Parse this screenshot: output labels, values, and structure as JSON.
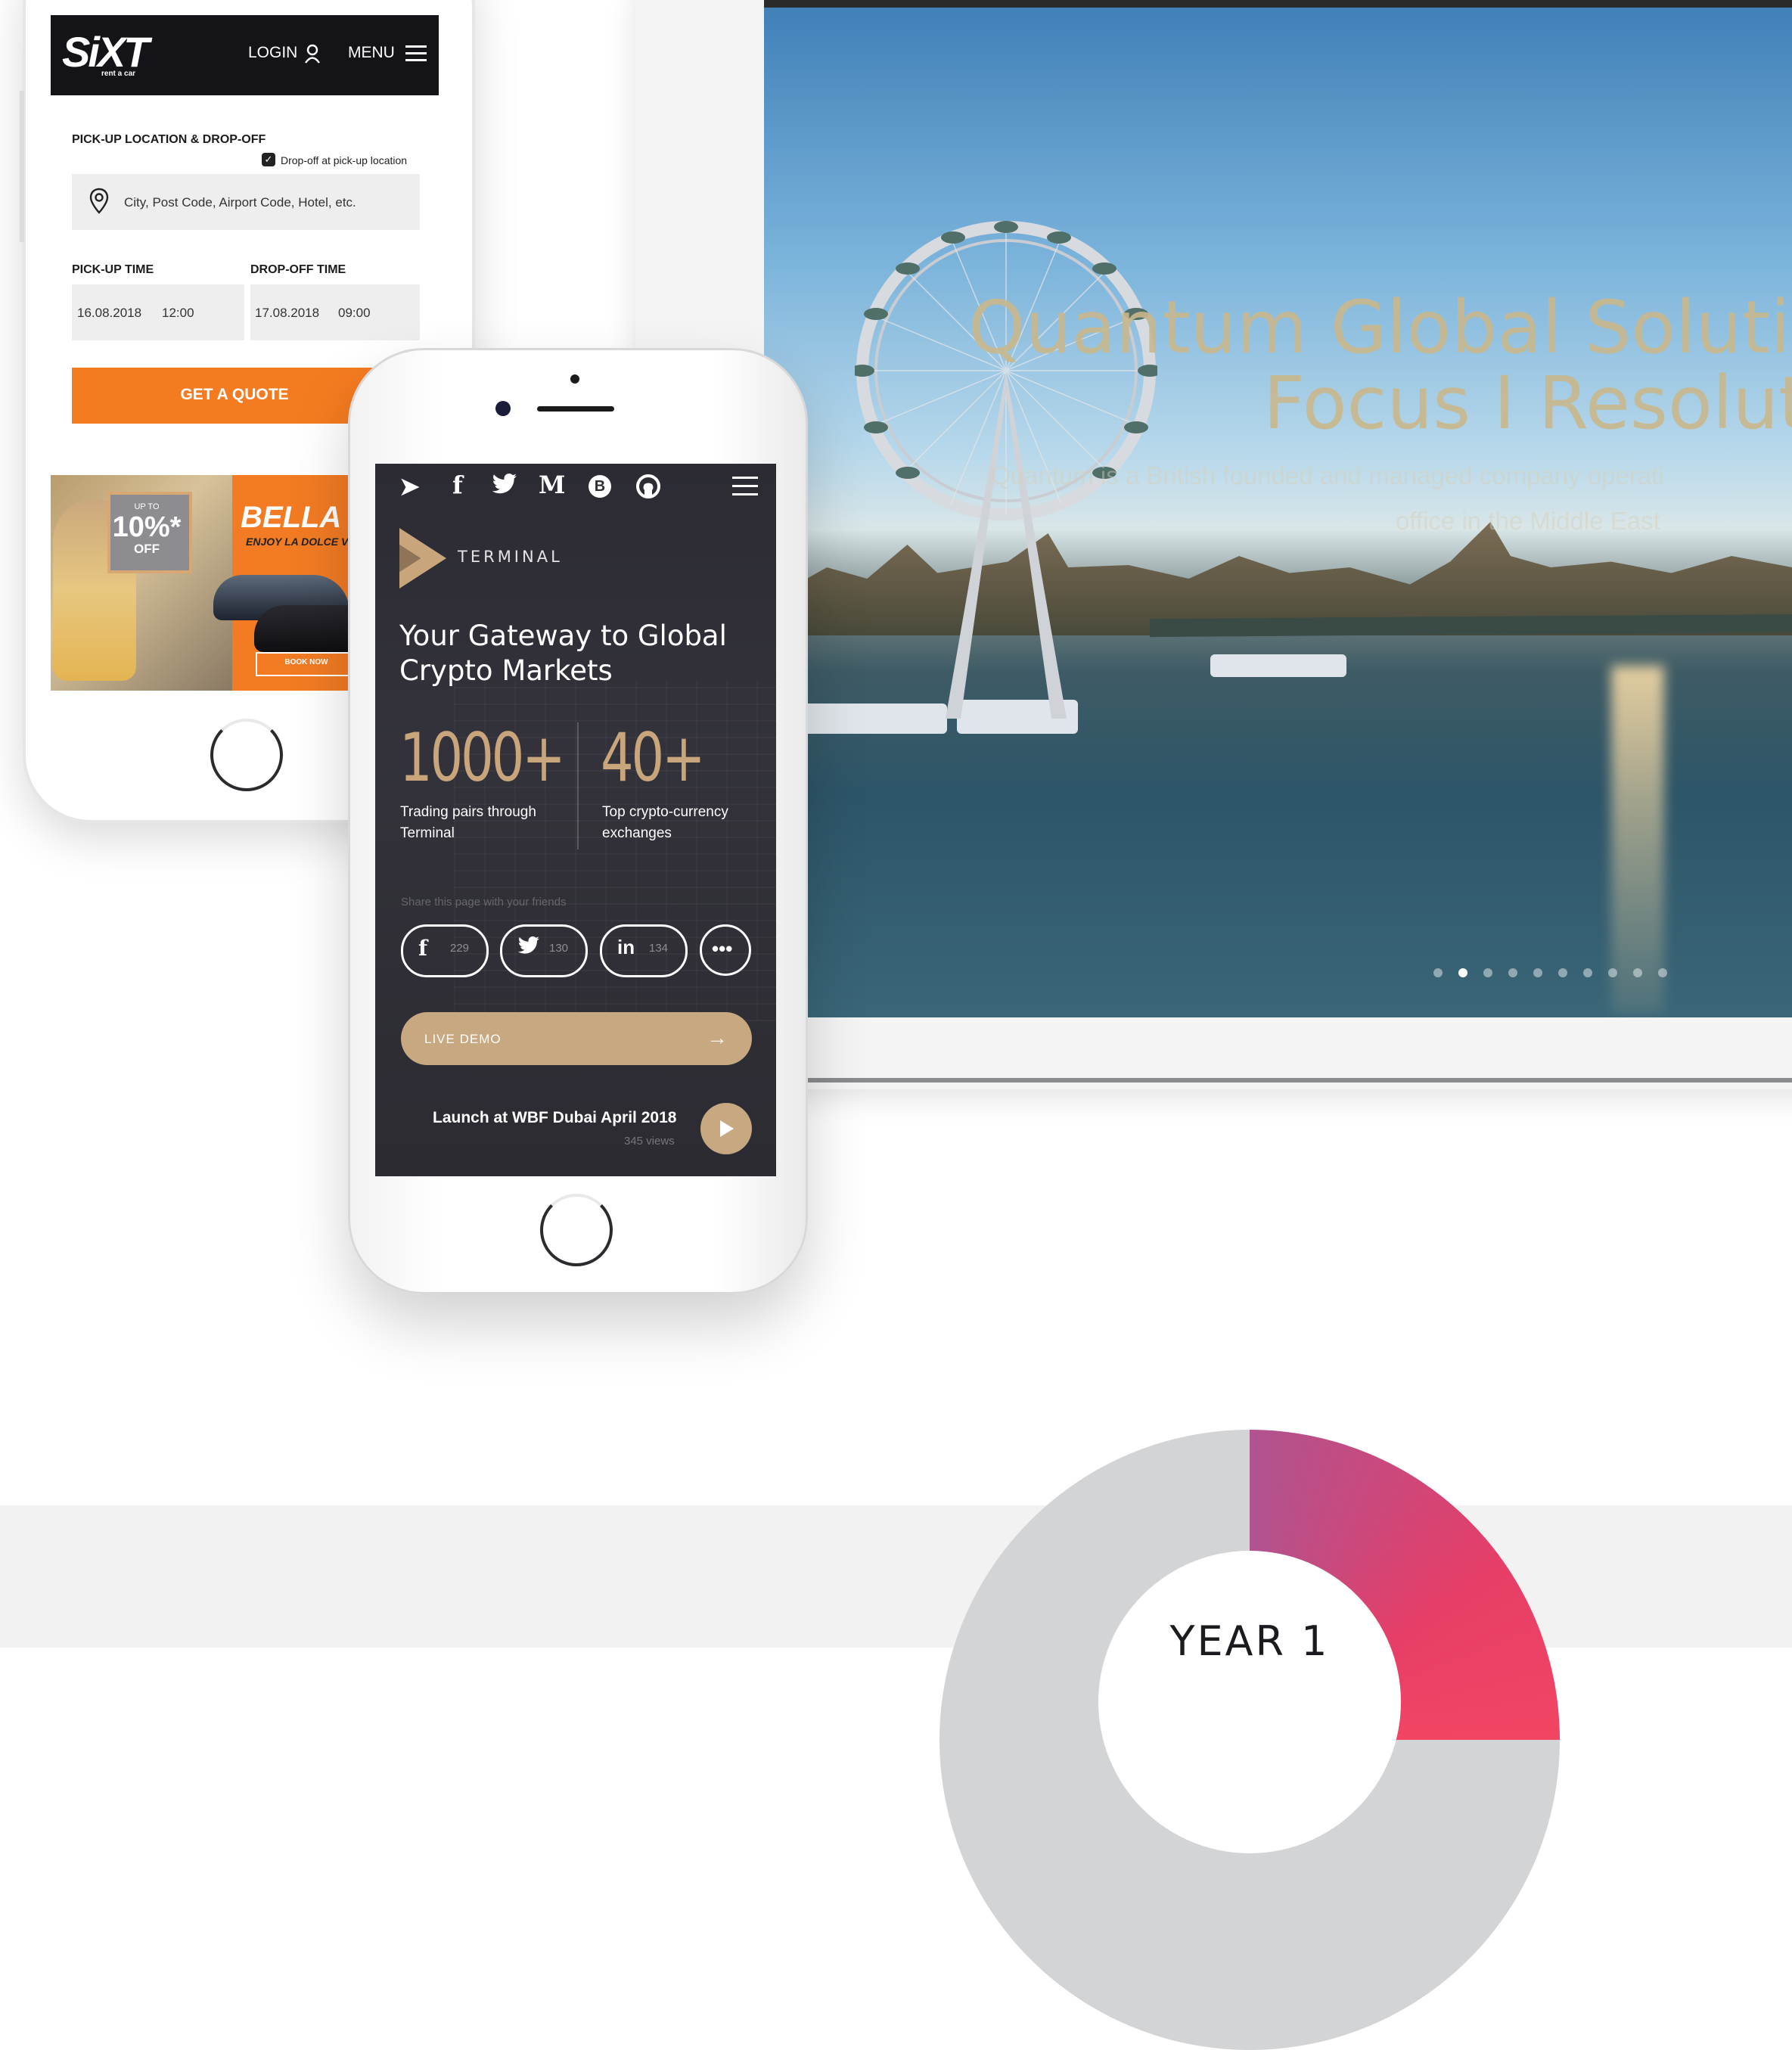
{
  "colors": {
    "sixt_orange": "#f57b20",
    "terminal_gold": "#c8a881",
    "terminal_dark": "#2e2d35",
    "donut_accent": "#e63e67",
    "donut_track": "#d3d4d6"
  },
  "sixt": {
    "logo": "SiXT",
    "logo_sub": "rent a car",
    "login_label": "LOGIN",
    "menu_label": "MENU",
    "pickup_heading": "PICK-UP LOCATION & DROP-OFF",
    "dropoff_checkbox_label": "Drop-off at pick-up location",
    "location_placeholder": "City, Post Code, Airport Code, Hotel, etc.",
    "pickup_time_label": "PICK-UP TIME",
    "dropoff_time_label": "DROP-OFF TIME",
    "pickup_date": "16.08.2018",
    "pickup_time": "12:00",
    "dropoff_date": "17.08.2018",
    "dropoff_time": "09:00",
    "quote_button": "GET A QUOTE",
    "banner": {
      "badge_upto": "UP TO",
      "badge_percent": "10%*",
      "badge_off": "OFF",
      "title": "BELLA I",
      "subtitle": "ENJOY LA DOLCE VI",
      "book_button": "BOOK NOW"
    }
  },
  "terminal": {
    "social_icons": [
      "telegram-icon",
      "facebook-icon",
      "twitter-icon",
      "medium-icon",
      "bitcoin-icon",
      "github-icon"
    ],
    "logo_text": "TERMINAL",
    "headline": "Your Gateway to Global Crypto Markets",
    "stats": [
      {
        "value": "1000+",
        "label": "Trading pairs through Terminal"
      },
      {
        "value": "40+",
        "label": "Top crypto-currency exchanges"
      }
    ],
    "share_hint": "Share this page with your friends",
    "shares": [
      {
        "network": "f",
        "count": "229"
      },
      {
        "network": "t",
        "count": "130"
      },
      {
        "network": "in",
        "count": "134"
      }
    ],
    "more_label": "•••",
    "demo_button": "LIVE DEMO",
    "launch_title": "Launch at WBF Dubai April 2018",
    "launch_views": "345 views"
  },
  "quantum": {
    "title_line1": "Quantum Global Solution",
    "title_line2": "Focus I Resolutio",
    "subtitle_line1": "Quantum is a British founded and managed company operati",
    "subtitle_line2": "office in the Middle East",
    "slide_count": 10,
    "active_slide": 2
  },
  "chart_data": {
    "type": "pie",
    "title": "YEAR 1",
    "values": [
      25,
      75
    ]
  }
}
